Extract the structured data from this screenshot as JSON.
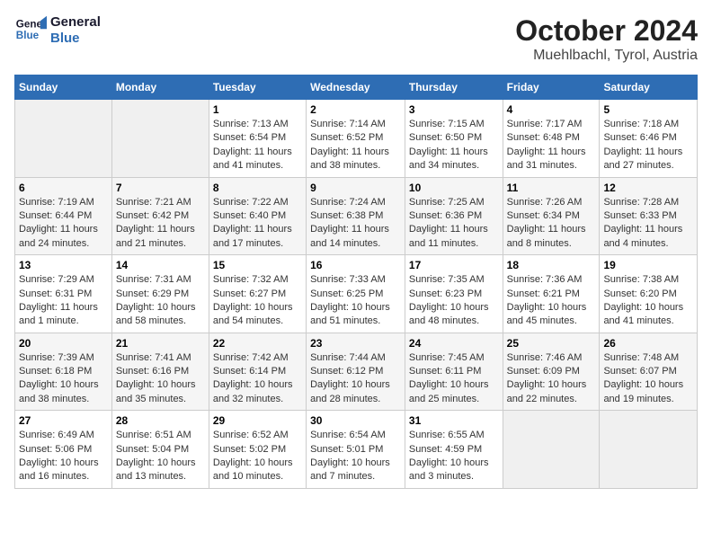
{
  "logo": {
    "line1": "General",
    "line2": "Blue"
  },
  "title": "October 2024",
  "subtitle": "Muehlbachl, Tyrol, Austria",
  "days_of_week": [
    "Sunday",
    "Monday",
    "Tuesday",
    "Wednesday",
    "Thursday",
    "Friday",
    "Saturday"
  ],
  "weeks": [
    [
      null,
      null,
      {
        "day": "1",
        "sunrise": "Sunrise: 7:13 AM",
        "sunset": "Sunset: 6:54 PM",
        "daylight": "Daylight: 11 hours and 41 minutes."
      },
      {
        "day": "2",
        "sunrise": "Sunrise: 7:14 AM",
        "sunset": "Sunset: 6:52 PM",
        "daylight": "Daylight: 11 hours and 38 minutes."
      },
      {
        "day": "3",
        "sunrise": "Sunrise: 7:15 AM",
        "sunset": "Sunset: 6:50 PM",
        "daylight": "Daylight: 11 hours and 34 minutes."
      },
      {
        "day": "4",
        "sunrise": "Sunrise: 7:17 AM",
        "sunset": "Sunset: 6:48 PM",
        "daylight": "Daylight: 11 hours and 31 minutes."
      },
      {
        "day": "5",
        "sunrise": "Sunrise: 7:18 AM",
        "sunset": "Sunset: 6:46 PM",
        "daylight": "Daylight: 11 hours and 27 minutes."
      }
    ],
    [
      {
        "day": "6",
        "sunrise": "Sunrise: 7:19 AM",
        "sunset": "Sunset: 6:44 PM",
        "daylight": "Daylight: 11 hours and 24 minutes."
      },
      {
        "day": "7",
        "sunrise": "Sunrise: 7:21 AM",
        "sunset": "Sunset: 6:42 PM",
        "daylight": "Daylight: 11 hours and 21 minutes."
      },
      {
        "day": "8",
        "sunrise": "Sunrise: 7:22 AM",
        "sunset": "Sunset: 6:40 PM",
        "daylight": "Daylight: 11 hours and 17 minutes."
      },
      {
        "day": "9",
        "sunrise": "Sunrise: 7:24 AM",
        "sunset": "Sunset: 6:38 PM",
        "daylight": "Daylight: 11 hours and 14 minutes."
      },
      {
        "day": "10",
        "sunrise": "Sunrise: 7:25 AM",
        "sunset": "Sunset: 6:36 PM",
        "daylight": "Daylight: 11 hours and 11 minutes."
      },
      {
        "day": "11",
        "sunrise": "Sunrise: 7:26 AM",
        "sunset": "Sunset: 6:34 PM",
        "daylight": "Daylight: 11 hours and 8 minutes."
      },
      {
        "day": "12",
        "sunrise": "Sunrise: 7:28 AM",
        "sunset": "Sunset: 6:33 PM",
        "daylight": "Daylight: 11 hours and 4 minutes."
      }
    ],
    [
      {
        "day": "13",
        "sunrise": "Sunrise: 7:29 AM",
        "sunset": "Sunset: 6:31 PM",
        "daylight": "Daylight: 11 hours and 1 minute."
      },
      {
        "day": "14",
        "sunrise": "Sunrise: 7:31 AM",
        "sunset": "Sunset: 6:29 PM",
        "daylight": "Daylight: 10 hours and 58 minutes."
      },
      {
        "day": "15",
        "sunrise": "Sunrise: 7:32 AM",
        "sunset": "Sunset: 6:27 PM",
        "daylight": "Daylight: 10 hours and 54 minutes."
      },
      {
        "day": "16",
        "sunrise": "Sunrise: 7:33 AM",
        "sunset": "Sunset: 6:25 PM",
        "daylight": "Daylight: 10 hours and 51 minutes."
      },
      {
        "day": "17",
        "sunrise": "Sunrise: 7:35 AM",
        "sunset": "Sunset: 6:23 PM",
        "daylight": "Daylight: 10 hours and 48 minutes."
      },
      {
        "day": "18",
        "sunrise": "Sunrise: 7:36 AM",
        "sunset": "Sunset: 6:21 PM",
        "daylight": "Daylight: 10 hours and 45 minutes."
      },
      {
        "day": "19",
        "sunrise": "Sunrise: 7:38 AM",
        "sunset": "Sunset: 6:20 PM",
        "daylight": "Daylight: 10 hours and 41 minutes."
      }
    ],
    [
      {
        "day": "20",
        "sunrise": "Sunrise: 7:39 AM",
        "sunset": "Sunset: 6:18 PM",
        "daylight": "Daylight: 10 hours and 38 minutes."
      },
      {
        "day": "21",
        "sunrise": "Sunrise: 7:41 AM",
        "sunset": "Sunset: 6:16 PM",
        "daylight": "Daylight: 10 hours and 35 minutes."
      },
      {
        "day": "22",
        "sunrise": "Sunrise: 7:42 AM",
        "sunset": "Sunset: 6:14 PM",
        "daylight": "Daylight: 10 hours and 32 minutes."
      },
      {
        "day": "23",
        "sunrise": "Sunrise: 7:44 AM",
        "sunset": "Sunset: 6:12 PM",
        "daylight": "Daylight: 10 hours and 28 minutes."
      },
      {
        "day": "24",
        "sunrise": "Sunrise: 7:45 AM",
        "sunset": "Sunset: 6:11 PM",
        "daylight": "Daylight: 10 hours and 25 minutes."
      },
      {
        "day": "25",
        "sunrise": "Sunrise: 7:46 AM",
        "sunset": "Sunset: 6:09 PM",
        "daylight": "Daylight: 10 hours and 22 minutes."
      },
      {
        "day": "26",
        "sunrise": "Sunrise: 7:48 AM",
        "sunset": "Sunset: 6:07 PM",
        "daylight": "Daylight: 10 hours and 19 minutes."
      }
    ],
    [
      {
        "day": "27",
        "sunrise": "Sunrise: 6:49 AM",
        "sunset": "Sunset: 5:06 PM",
        "daylight": "Daylight: 10 hours and 16 minutes."
      },
      {
        "day": "28",
        "sunrise": "Sunrise: 6:51 AM",
        "sunset": "Sunset: 5:04 PM",
        "daylight": "Daylight: 10 hours and 13 minutes."
      },
      {
        "day": "29",
        "sunrise": "Sunrise: 6:52 AM",
        "sunset": "Sunset: 5:02 PM",
        "daylight": "Daylight: 10 hours and 10 minutes."
      },
      {
        "day": "30",
        "sunrise": "Sunrise: 6:54 AM",
        "sunset": "Sunset: 5:01 PM",
        "daylight": "Daylight: 10 hours and 7 minutes."
      },
      {
        "day": "31",
        "sunrise": "Sunrise: 6:55 AM",
        "sunset": "Sunset: 4:59 PM",
        "daylight": "Daylight: 10 hours and 3 minutes."
      },
      null,
      null
    ]
  ]
}
